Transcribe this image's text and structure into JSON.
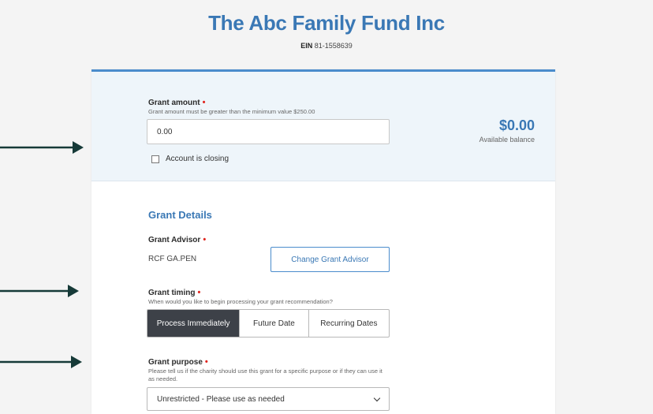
{
  "org": {
    "title": "The Abc Family Fund Inc",
    "ein_label": "EIN",
    "ein_value": "81-1558639"
  },
  "amount": {
    "label": "Grant amount",
    "hint": "Grant amount must be greater than the minimum value $250.00",
    "value": "0.00",
    "checkbox_label": "Account is closing",
    "balance": "$0.00",
    "balance_label": "Available balance"
  },
  "details": {
    "title": "Grant Details",
    "advisor_label": "Grant Advisor",
    "advisor_value": "RCF GA.PEN",
    "change_advisor": "Change Grant Advisor",
    "timing_label": "Grant timing",
    "timing_hint": "When would you like to begin processing your grant recommendation?",
    "timing_options": [
      "Process Immediately",
      "Future Date",
      "Recurring Dates"
    ],
    "timing_selected": "Process Immediately",
    "purpose_label": "Grant purpose",
    "purpose_hint": "Please tell us if the charity should use this grant for a specific purpose or if they can use it as needed.",
    "purpose_value": "Unrestricted - Please use as needed"
  },
  "required_marker": "•",
  "colors": {
    "accent": "#3a78b5",
    "required": "#e0231c",
    "selected_segment": "#3d4148",
    "arrow": "#163a38"
  }
}
